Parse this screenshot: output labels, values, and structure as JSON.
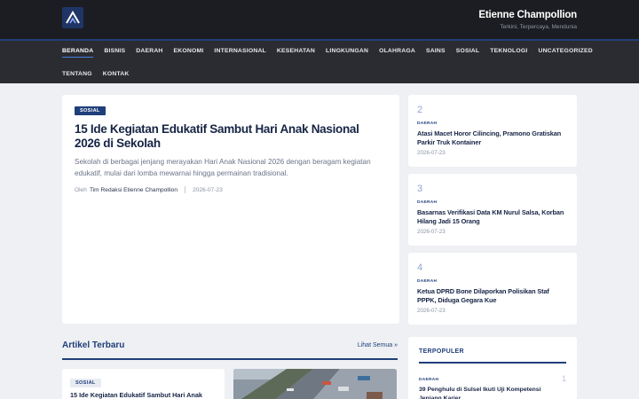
{
  "header": {
    "site_title": "Etienne Champollion",
    "tagline": "Terkini, Terpercaya, Mendunia",
    "logo_icon": "logo-chevron-icon"
  },
  "nav": {
    "row1": [
      "BERANDA",
      "BISNIS",
      "DAERAH",
      "EKONOMI",
      "INTERNASIONAL",
      "KESEHATAN",
      "LINGKUNGAN",
      "OLAHRAGA",
      "SAINS",
      "SOSIAL",
      "TEKNOLOGI",
      "UNCATEGORIZED"
    ],
    "row2": [
      "TENTANG",
      "KONTAK"
    ],
    "active": "BERANDA"
  },
  "featured": {
    "category": "SOSIAL",
    "title": "15 Ide Kegiatan Edukatif Sambut Hari Anak Nasional 2026 di Sekolah",
    "excerpt": "Sekolah di berbagai jenjang merayakan Hari Anak Nasional 2026 dengan beragam kegiatan edukatif, mulai dari lomba mewarnai hingga permainan tradisional.",
    "by_prefix": "Oleh",
    "author": "Tim Redaksi Etienne Champollion",
    "date": "2026-07-23"
  },
  "side_articles": [
    {
      "num": "2",
      "category": "DAERAH",
      "title": "Atasi Macet Horor Cilincing, Pramono Gratiskan Parkir Truk Kontainer",
      "date": "2026-07-23"
    },
    {
      "num": "3",
      "category": "DAERAH",
      "title": "Basarnas Verifikasi Data KM Nurul Salsa, Korban Hilang Jadi 15 Orang",
      "date": "2026-07-23"
    },
    {
      "num": "4",
      "category": "DAERAH",
      "title": "Ketua DPRD Bone Dilaporkan Polisikan Staf PPPK, Diduga Gegara Kue",
      "date": "2026-07-23"
    }
  ],
  "latest": {
    "section_title": "Artikel Terbaru",
    "see_all": "Lihat Semua »",
    "card": {
      "category": "SOSIAL",
      "title": "15 Ide Kegiatan Edukatif Sambut Hari Anak"
    }
  },
  "popular": {
    "heading": "TERPOPULER",
    "item": {
      "num": "1",
      "category": "DAERAH",
      "title": "39 Penghulu di Sulsel Ikuti Uji Kompetensi Jenjang Karier"
    }
  },
  "colors": {
    "accent": "#1f3f7a",
    "topbar": "#1b1d22",
    "navbar": "#2a2c31",
    "background": "#eef0f3"
  }
}
